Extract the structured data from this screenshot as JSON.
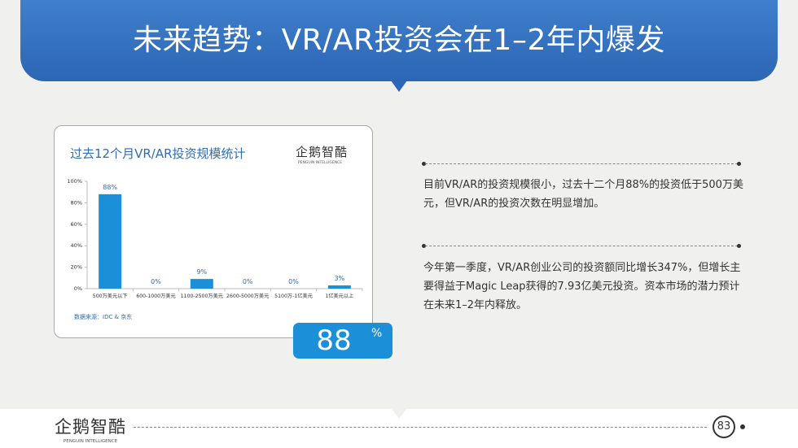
{
  "slide": {
    "title": "未来趋势：VR/AR投资会在1–2年内爆发",
    "page_number": "83"
  },
  "brand": {
    "name": "企鹅智酷",
    "sub": "PENGUIN INTELLIGENCE"
  },
  "colors": {
    "banner": "#2c66b5",
    "bar": "#1b8fd8",
    "accent_text": "#2f6db4",
    "background": "#f0f1ee"
  },
  "chart_data": {
    "type": "bar",
    "title": "过去12个月VR/AR投资规模统计",
    "categories": [
      "500万美元以下",
      "600-1000万美元",
      "1100-2500万美元",
      "2600-5000万美元",
      "5100万-1亿美元",
      "1亿美元以上"
    ],
    "values": [
      88,
      0,
      9,
      0,
      0,
      3
    ],
    "data_labels": [
      "88%",
      "0%",
      "9%",
      "0%",
      "0%",
      "3%"
    ],
    "yticks": [
      "0%",
      "20%",
      "40%",
      "60%",
      "80%",
      "100%"
    ],
    "ylim": [
      0,
      100
    ],
    "grid": false,
    "source": "数据来源：IDC & 京东"
  },
  "highlight": {
    "value": "88",
    "unit": "%"
  },
  "paragraphs": [
    "目前VR/AR的投资规模很小，过去十二个月88%的投资低于500万美元，但VR/AR的投资次数在明显增加。",
    "今年第一季度，VR/AR创业公司的投资额同比增长347%，但增长主要得益于Magic Leap获得的7.93亿美元投资。资本市场的潜力预计在未来1–2年内释放。"
  ]
}
